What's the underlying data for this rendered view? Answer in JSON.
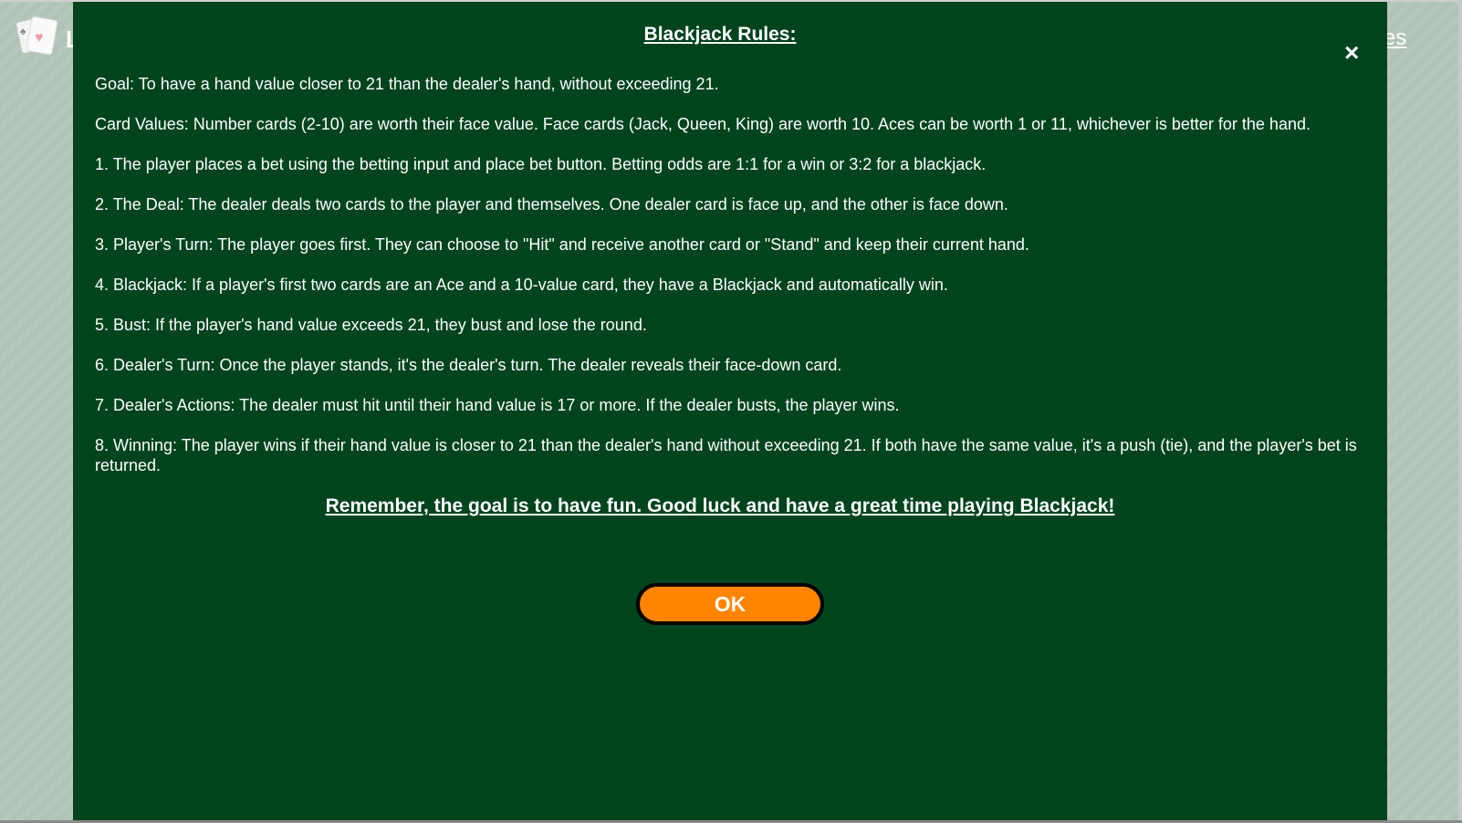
{
  "background": {
    "brand_partial": "L",
    "rules_link": "Rules"
  },
  "modal": {
    "title": "Blackjack Rules:",
    "close_icon": "×",
    "rules": [
      "Goal: To have a hand value closer to 21 than the dealer's hand, without exceeding 21.",
      "Card Values: Number cards (2-10) are worth their face value. Face cards (Jack, Queen, King) are worth 10. Aces can be worth 1 or 11, whichever is better for the hand.",
      "1. The player places a bet using the betting input and place bet button. Betting odds are 1:1 for a win or 3:2 for a blackjack.",
      "2. The Deal: The dealer deals two cards to the player and themselves. One dealer card is face up, and the other is face down.",
      "3. Player's Turn: The player goes first. They can choose to \"Hit\" and receive another card or \"Stand\" and keep their current hand.",
      "4. Blackjack: If a player's first two cards are an Ace and a 10-value card, they have a Blackjack and automatically win.",
      "5. Bust: If the player's hand value exceeds 21, they bust and lose the round.",
      "6. Dealer's Turn: Once the player stands, it's the dealer's turn. The dealer reveals their face-down card.",
      "7. Dealer's Actions: The dealer must hit until their hand value is 17 or more. If the dealer busts, the player wins.",
      "8. Winning: The player wins if their hand value is closer to 21 than the dealer's hand without exceeding 21. If both have the same value, it's a push (tie), and the player's bet is returned."
    ],
    "remember": "Remember, the goal is to have fun. Good luck and have a great time playing Blackjack!",
    "ok_label": "OK"
  },
  "colors": {
    "modal_bg": "#00441d",
    "button": "#ff8400"
  }
}
